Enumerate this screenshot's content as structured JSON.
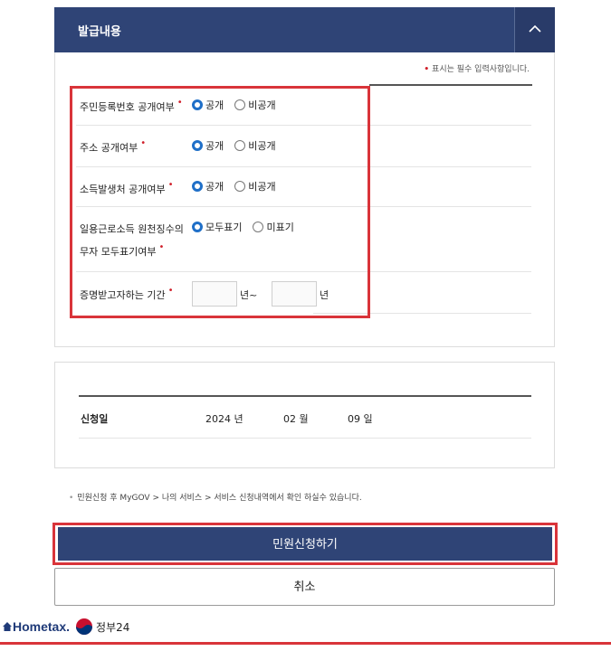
{
  "header": {
    "title": "발급내용"
  },
  "required_note": "표시는 필수 입력사항입니다.",
  "fields": [
    {
      "label": "주민등록번호 공개여부",
      "options": [
        "공개",
        "비공개"
      ],
      "selected": 0
    },
    {
      "label": "주소 공개여부",
      "options": [
        "공개",
        "비공개"
      ],
      "selected": 0
    },
    {
      "label": "소득발생처 공개여부",
      "options": [
        "공개",
        "비공개"
      ],
      "selected": 0
    },
    {
      "label_line1": "일용근로소득 원천징수의",
      "label_line2": "무자 모두표기여부",
      "options": [
        "모두표기",
        "미표기"
      ],
      "selected": 0
    },
    {
      "label": "증명받고자하는 기간",
      "from_value": "",
      "from_unit": "년~",
      "to_value": "",
      "to_unit": "년"
    }
  ],
  "application_date": {
    "label": "신청일",
    "year": "2024 년",
    "month": "02 월",
    "day": "09 일"
  },
  "notice": "민원신청 후 MyGOV > 나의 서비스 > 서비스 신청내역에서 확인 하실수 있습니다.",
  "buttons": {
    "submit": "민원신청하기",
    "cancel": "취소"
  },
  "footer": {
    "hometax_logo": "Hometax.",
    "gov_label": "정부24"
  },
  "colors": {
    "navy": "#2f4476",
    "highlight_red": "#d9343a",
    "radio_blue": "#1f6fc8"
  }
}
